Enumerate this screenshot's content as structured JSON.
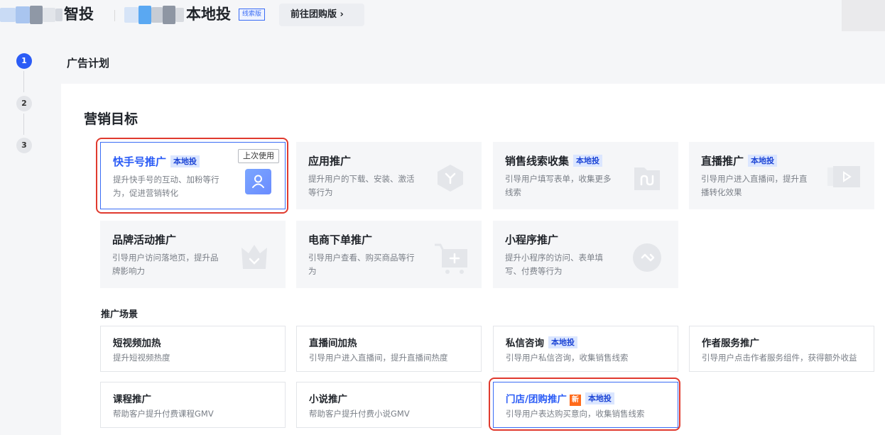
{
  "header": {
    "brand_suffix": "智投",
    "product_name": "本地投",
    "version_tag": "线索版",
    "goto_button": "前往团购版 ›"
  },
  "stepper": {
    "steps": [
      "1",
      "2",
      "3"
    ],
    "current_step_title": "广告计划"
  },
  "marketing_goal": {
    "title": "营销目标",
    "cards": [
      {
        "title": "快手号推广",
        "tag": "本地投",
        "desc": "提升快手号的互动、加粉等行为，促进营销转化",
        "badge": "上次使用",
        "icon": "user-icon",
        "selected": true
      },
      {
        "title": "应用推广",
        "tag": "",
        "desc": "提升用户的下载、安装、激活等行为",
        "icon": "app-hexagon-icon"
      },
      {
        "title": "销售线索收集",
        "tag": "本地投",
        "desc": "引导用户填写表单，收集更多线索",
        "icon": "folder-icon"
      },
      {
        "title": "直播推广",
        "tag": "本地投",
        "desc": "引导用户进入直播间，提升直播转化效果",
        "icon": "play-icon"
      },
      {
        "title": "品牌活动推广",
        "tag": "",
        "desc": "引导用户访问落地页，提升品牌影响力",
        "icon": "crown-icon"
      },
      {
        "title": "电商下单推广",
        "tag": "",
        "desc": "引导用户查看、购买商品等行为",
        "icon": "cart-icon"
      },
      {
        "title": "小程序推广",
        "tag": "",
        "desc": "提升小程序的访问、表单填写、付费等行为",
        "icon": "mini-program-icon"
      }
    ]
  },
  "scenes": {
    "title": "推广场景",
    "cards": [
      {
        "title": "短视频加热",
        "tag": "",
        "desc": "提升短视频热度"
      },
      {
        "title": "直播间加热",
        "tag": "",
        "desc": "引导用户进入直播间，提升直播间热度"
      },
      {
        "title": "私信咨询",
        "tag": "本地投",
        "desc": "引导用户私信咨询，收集销售线索"
      },
      {
        "title": "作者服务推广",
        "tag": "",
        "desc": "引导用户点击作者服务组件，获得额外收益"
      },
      {
        "title": "课程推广",
        "tag": "",
        "desc": "帮助客户提升付费课程GMV"
      },
      {
        "title": "小说推广",
        "tag": "",
        "desc": "帮助客户提升付费小说GMV"
      },
      {
        "title": "门店/团购推广",
        "new_badge": "新",
        "tag": "本地投",
        "desc": "引导用户表达购买意向，收集销售线索",
        "selected": true
      }
    ]
  },
  "colors": {
    "accent": "#2b5cf6",
    "tag_bg": "#dbe6ff",
    "highlight_ring": "#e03a2e",
    "new_badge": "#ff6a1a"
  }
}
